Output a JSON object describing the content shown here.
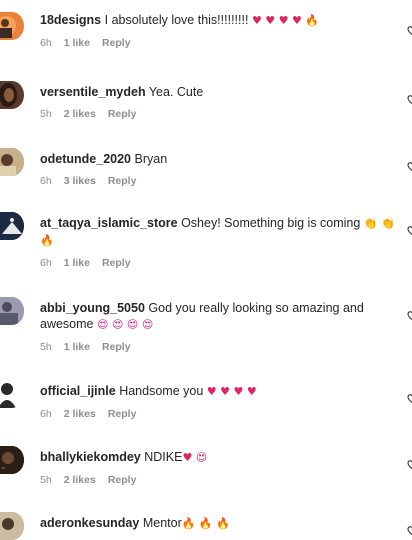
{
  "comments": [
    {
      "username": "18designs",
      "text": "I absolutely love this!!!!!!!!!",
      "emojis": [
        {
          "char": "♥",
          "type": "red"
        },
        {
          "char": "♥",
          "type": "red"
        },
        {
          "char": "♥",
          "type": "red"
        },
        {
          "char": "♥",
          "type": "red"
        },
        {
          "char": "🔥",
          "type": "fire"
        }
      ],
      "time": "6h",
      "likes": "1 like",
      "reply": "Reply",
      "avatar_color": "#e8823c"
    },
    {
      "username": "versentile_mydeh",
      "text": "Yea. Cute",
      "emojis": [],
      "time": "5h",
      "likes": "2 likes",
      "reply": "Reply",
      "avatar_color": "#5a3a2e"
    },
    {
      "username": "odetunde_2020",
      "text": "Bryan",
      "emojis": [],
      "time": "6h",
      "likes": "3 likes",
      "reply": "Reply",
      "avatar_color": "#9a7d5c"
    },
    {
      "username": "at_taqya_islamic_store",
      "text": "Oshey! Something big is coming",
      "emojis": [
        {
          "char": "👏",
          "type": "clap"
        },
        {
          "char": "👏",
          "type": "clap"
        },
        {
          "char": "🔥",
          "type": "fire"
        }
      ],
      "time": "6h",
      "likes": "1 like",
      "reply": "Reply",
      "avatar_color": "#1d2a44"
    },
    {
      "username": "abbi_young_5050",
      "text": "God you really looking so amazing and awesome",
      "emojis": [
        {
          "char": "😍",
          "type": "pink"
        },
        {
          "char": "😍",
          "type": "pink"
        },
        {
          "char": "😍",
          "type": "pink"
        },
        {
          "char": "😍",
          "type": "pink"
        }
      ],
      "time": "5h",
      "likes": "1 like",
      "reply": "Reply",
      "avatar_color": "#7e7e94"
    },
    {
      "username": "official_ijinle",
      "text": "Handsome you",
      "emojis": [
        {
          "char": "♥",
          "type": "red"
        },
        {
          "char": "♥",
          "type": "red"
        },
        {
          "char": "♥",
          "type": "red"
        },
        {
          "char": "♥",
          "type": "red"
        }
      ],
      "time": "6h",
      "likes": "2 likes",
      "reply": "Reply",
      "avatar_color": "#3a3a3a"
    },
    {
      "username": "bhallykiekomdey",
      "text": "NDIKE",
      "emojis": [
        {
          "char": "♥",
          "type": "red"
        },
        {
          "char": "😍",
          "type": "pink"
        }
      ],
      "time": "5h",
      "likes": "2 likes",
      "reply": "Reply",
      "avatar_color": "#2b1e16"
    },
    {
      "username": "aderonkesunday",
      "text": "Mentor",
      "emojis": [
        {
          "char": "🔥",
          "type": "fire"
        },
        {
          "char": "🔥",
          "type": "fire"
        },
        {
          "char": "🔥",
          "type": "fire"
        }
      ],
      "time": "",
      "likes": "",
      "reply": "",
      "avatar_color": "#b7a48a"
    }
  ],
  "icons": {
    "like": "heart-outline-icon"
  },
  "colors": {
    "meta": "#8e8e8e",
    "text": "#262626",
    "heart_red": "#e0245e",
    "fire": "#f2720c"
  }
}
